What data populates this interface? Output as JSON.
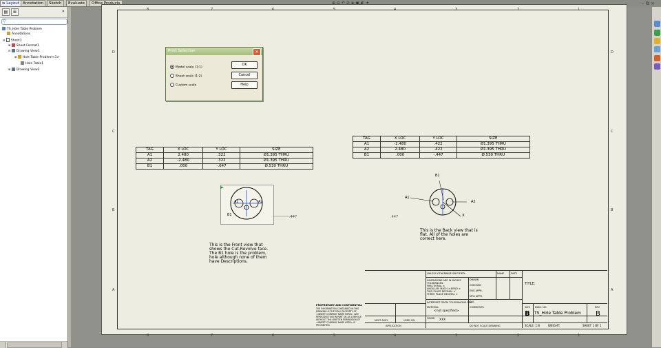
{
  "tabs": [
    "w Layout",
    "Annotation",
    "Sketch",
    "Evaluate",
    "Office Products"
  ],
  "feature_tree": {
    "root": "TS_Hole Table Problem",
    "items": [
      {
        "label": "Annotations",
        "level": 1
      },
      {
        "label": "Sheet1",
        "level": 1
      },
      {
        "label": "Sheet Format1",
        "level": 2
      },
      {
        "label": "Drawing View1",
        "level": 2
      },
      {
        "label": "Hole Table Problem<1>",
        "level": 3
      },
      {
        "label": "Hole Table1",
        "level": 3
      },
      {
        "label": "Drawing View2",
        "level": 2
      }
    ]
  },
  "window_controls": [
    "–",
    "⧉",
    "×"
  ],
  "zones": {
    "top": [
      "8",
      "7",
      "6",
      "5",
      "4",
      "3",
      "2",
      "1"
    ],
    "bottom": [
      "8",
      "7",
      "6",
      "5",
      "4",
      "3",
      "2",
      "1"
    ],
    "left": [
      "D",
      "C",
      "B",
      "A"
    ],
    "right": [
      "D",
      "C",
      "B",
      "A"
    ]
  },
  "dialog": {
    "title": "Print Selection",
    "options": [
      "Model scale (1:1)",
      "Sheet scale (1:2)",
      "Custom scale"
    ],
    "selected": 0,
    "buttons": [
      "OK",
      "Cancel",
      "Help"
    ]
  },
  "hole_table_left": {
    "headers": [
      "TAG",
      "X LOC",
      "Y LOC",
      "SIZE"
    ],
    "rows": [
      [
        "A1",
        "2.480",
        ".322",
        "Ø1.395 THRU"
      ],
      [
        "A2",
        "-2.480",
        ".322",
        "Ø1.395 THRU"
      ],
      [
        "B1",
        ".000",
        "-.647",
        "Ø.530 THRU"
      ]
    ]
  },
  "hole_table_right": {
    "headers": [
      "TAG",
      "X LOC",
      "Y LOC",
      "SIZE"
    ],
    "rows": [
      [
        "A1",
        "-2.480",
        ".422",
        "Ø1.395 THRU"
      ],
      [
        "A2",
        "2.480",
        ".422",
        "Ø1.395 THRU"
      ],
      [
        "B1",
        ".000",
        "-.447",
        "Ø.530 THRU"
      ]
    ]
  },
  "front_view": {
    "labels": [
      "A1",
      "A2",
      "B1",
      ".447"
    ],
    "note": "This is the Front view that shows the Cut-Revolve face. The B1 hole is the problem, hole although none of them have Descriptions."
  },
  "back_view": {
    "labels": [
      "B1",
      "A1",
      "A2",
      "X",
      ".447"
    ],
    "note": "This is the Back view that is flat. All of the holes are correct here."
  },
  "title_block": {
    "unless": "UNLESS OTHERWISE SPECIFIED:",
    "name": "NAME",
    "date": "DATE",
    "dims": "DIMENSIONS ARE IN INCHES",
    "tolerances": "TOLERANCES:",
    "fractional": "FRACTIONAL ±",
    "angular": "ANGULAR: MACH ±  BEND ±",
    "two_place": "TWO PLACE DECIMAL  ±",
    "three_place": "THREE PLACE DECIMAL  ±",
    "drawn": "DRAWN",
    "checked": "CHECKED",
    "eng_appr": "ENG APPR.",
    "mfg_appr": "MFG APPR.",
    "qa": "Q.A.",
    "comments": "COMMENTS:",
    "interpret": "INTERPRET GEOM TOLERANCING PER:",
    "material": "MATERIAL",
    "material_value": "<not specified>",
    "finish": "FINISH",
    "finish_value": "XXX",
    "next_assy": "NEXT ASSY",
    "used_on": "USED ON",
    "application": "APPLICATION",
    "do_not_scale": "DO NOT SCALE DRAWING",
    "proprietary": "PROPRIETARY AND CONFIDENTIAL",
    "proprietary_text": "THE INFORMATION CONTAINED IN THIS DRAWING IS THE SOLE PROPERTY OF <INSERT COMPANY NAME HERE>. ANY REPRODUCTION IN PART OR AS A WHOLE WITHOUT THE WRITTEN PERMISSION OF <INSERT COMPANY NAME HERE> IS PROHIBITED.",
    "title_label": "TITLE:",
    "size_label": "SIZE",
    "size": "B",
    "dwg_label": "DWG. NO.",
    "dwg": "TS_Hole Table Problem",
    "rev_label": "REV",
    "rev": "B",
    "scale": "SCALE: 1:8",
    "weight": "WEIGHT:",
    "sheet": "SHEET 1 OF 1"
  },
  "colors": {
    "sheet": "#edede2",
    "canvas": "#8f918a",
    "dialog_title": "#a4bc7c",
    "selection": "#1e4cc8"
  }
}
